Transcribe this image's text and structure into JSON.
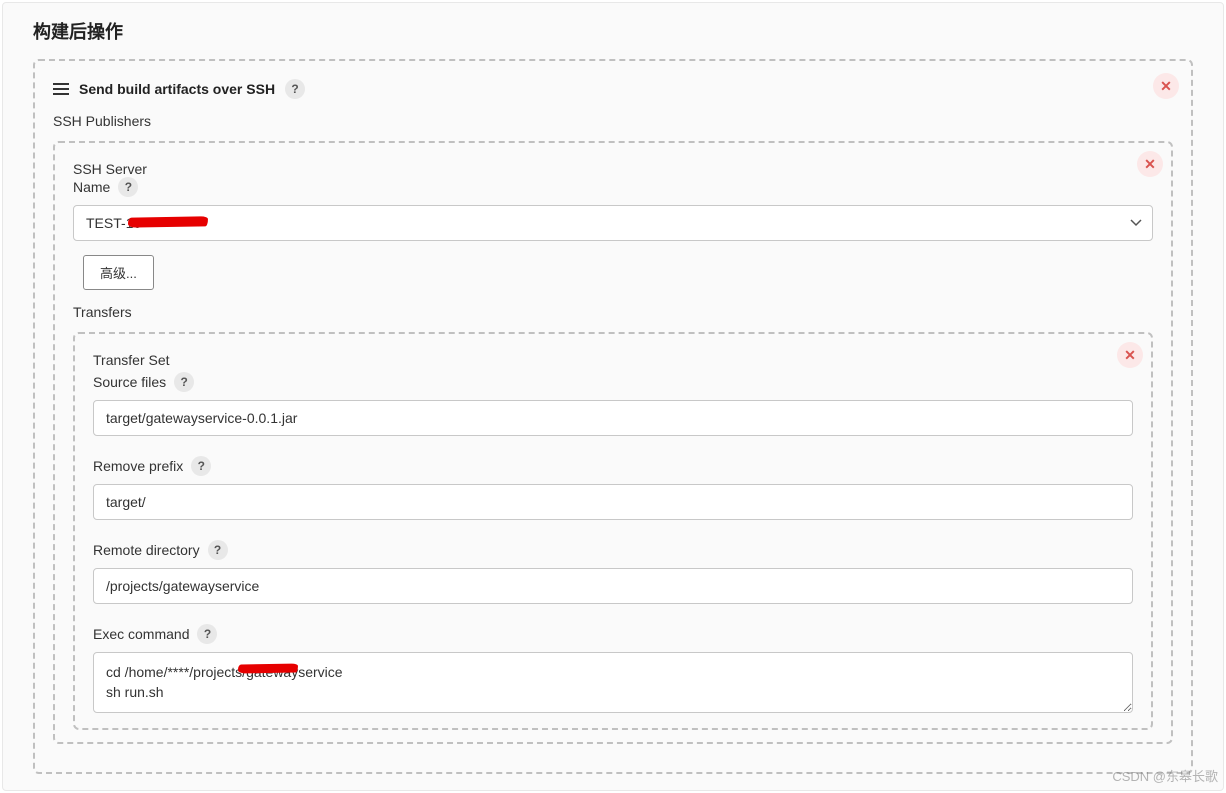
{
  "section": {
    "title": "构建后操作"
  },
  "panel": {
    "title": "Send build artifacts over SSH",
    "help": "?",
    "publishers_label": "SSH Publishers"
  },
  "server": {
    "label": "SSH Server",
    "name_label": "Name",
    "name_help": "?",
    "selected": "TEST-10",
    "advanced_btn": "高级..."
  },
  "transfers": {
    "label": "Transfers",
    "set_label": "Transfer Set",
    "source_files_label": "Source files",
    "source_files_help": "?",
    "source_files_value": "target/gatewayservice-0.0.1.jar",
    "remove_prefix_label": "Remove prefix",
    "remove_prefix_help": "?",
    "remove_prefix_value": "target/",
    "remote_dir_label": "Remote directory",
    "remote_dir_help": "?",
    "remote_dir_value": "/projects/gatewayservice",
    "exec_label": "Exec command",
    "exec_help": "?",
    "exec_value": "cd /home/****/projects/gatewayservice\nsh run.sh"
  },
  "watermark": "CSDN @东皋长歌"
}
